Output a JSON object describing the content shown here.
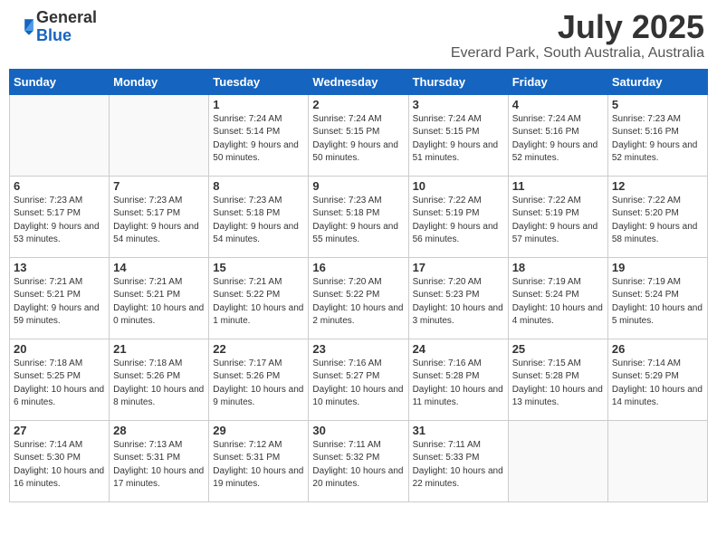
{
  "header": {
    "logo_general": "General",
    "logo_blue": "Blue",
    "month_year": "July 2025",
    "location": "Everard Park, South Australia, Australia"
  },
  "days_of_week": [
    "Sunday",
    "Monday",
    "Tuesday",
    "Wednesday",
    "Thursday",
    "Friday",
    "Saturday"
  ],
  "weeks": [
    [
      {
        "day": "",
        "info": ""
      },
      {
        "day": "",
        "info": ""
      },
      {
        "day": "1",
        "info": "Sunrise: 7:24 AM\nSunset: 5:14 PM\nDaylight: 9 hours and 50 minutes."
      },
      {
        "day": "2",
        "info": "Sunrise: 7:24 AM\nSunset: 5:15 PM\nDaylight: 9 hours and 50 minutes."
      },
      {
        "day": "3",
        "info": "Sunrise: 7:24 AM\nSunset: 5:15 PM\nDaylight: 9 hours and 51 minutes."
      },
      {
        "day": "4",
        "info": "Sunrise: 7:24 AM\nSunset: 5:16 PM\nDaylight: 9 hours and 52 minutes."
      },
      {
        "day": "5",
        "info": "Sunrise: 7:23 AM\nSunset: 5:16 PM\nDaylight: 9 hours and 52 minutes."
      }
    ],
    [
      {
        "day": "6",
        "info": "Sunrise: 7:23 AM\nSunset: 5:17 PM\nDaylight: 9 hours and 53 minutes."
      },
      {
        "day": "7",
        "info": "Sunrise: 7:23 AM\nSunset: 5:17 PM\nDaylight: 9 hours and 54 minutes."
      },
      {
        "day": "8",
        "info": "Sunrise: 7:23 AM\nSunset: 5:18 PM\nDaylight: 9 hours and 54 minutes."
      },
      {
        "day": "9",
        "info": "Sunrise: 7:23 AM\nSunset: 5:18 PM\nDaylight: 9 hours and 55 minutes."
      },
      {
        "day": "10",
        "info": "Sunrise: 7:22 AM\nSunset: 5:19 PM\nDaylight: 9 hours and 56 minutes."
      },
      {
        "day": "11",
        "info": "Sunrise: 7:22 AM\nSunset: 5:19 PM\nDaylight: 9 hours and 57 minutes."
      },
      {
        "day": "12",
        "info": "Sunrise: 7:22 AM\nSunset: 5:20 PM\nDaylight: 9 hours and 58 minutes."
      }
    ],
    [
      {
        "day": "13",
        "info": "Sunrise: 7:21 AM\nSunset: 5:21 PM\nDaylight: 9 hours and 59 minutes."
      },
      {
        "day": "14",
        "info": "Sunrise: 7:21 AM\nSunset: 5:21 PM\nDaylight: 10 hours and 0 minutes."
      },
      {
        "day": "15",
        "info": "Sunrise: 7:21 AM\nSunset: 5:22 PM\nDaylight: 10 hours and 1 minute."
      },
      {
        "day": "16",
        "info": "Sunrise: 7:20 AM\nSunset: 5:22 PM\nDaylight: 10 hours and 2 minutes."
      },
      {
        "day": "17",
        "info": "Sunrise: 7:20 AM\nSunset: 5:23 PM\nDaylight: 10 hours and 3 minutes."
      },
      {
        "day": "18",
        "info": "Sunrise: 7:19 AM\nSunset: 5:24 PM\nDaylight: 10 hours and 4 minutes."
      },
      {
        "day": "19",
        "info": "Sunrise: 7:19 AM\nSunset: 5:24 PM\nDaylight: 10 hours and 5 minutes."
      }
    ],
    [
      {
        "day": "20",
        "info": "Sunrise: 7:18 AM\nSunset: 5:25 PM\nDaylight: 10 hours and 6 minutes."
      },
      {
        "day": "21",
        "info": "Sunrise: 7:18 AM\nSunset: 5:26 PM\nDaylight: 10 hours and 8 minutes."
      },
      {
        "day": "22",
        "info": "Sunrise: 7:17 AM\nSunset: 5:26 PM\nDaylight: 10 hours and 9 minutes."
      },
      {
        "day": "23",
        "info": "Sunrise: 7:16 AM\nSunset: 5:27 PM\nDaylight: 10 hours and 10 minutes."
      },
      {
        "day": "24",
        "info": "Sunrise: 7:16 AM\nSunset: 5:28 PM\nDaylight: 10 hours and 11 minutes."
      },
      {
        "day": "25",
        "info": "Sunrise: 7:15 AM\nSunset: 5:28 PM\nDaylight: 10 hours and 13 minutes."
      },
      {
        "day": "26",
        "info": "Sunrise: 7:14 AM\nSunset: 5:29 PM\nDaylight: 10 hours and 14 minutes."
      }
    ],
    [
      {
        "day": "27",
        "info": "Sunrise: 7:14 AM\nSunset: 5:30 PM\nDaylight: 10 hours and 16 minutes."
      },
      {
        "day": "28",
        "info": "Sunrise: 7:13 AM\nSunset: 5:31 PM\nDaylight: 10 hours and 17 minutes."
      },
      {
        "day": "29",
        "info": "Sunrise: 7:12 AM\nSunset: 5:31 PM\nDaylight: 10 hours and 19 minutes."
      },
      {
        "day": "30",
        "info": "Sunrise: 7:11 AM\nSunset: 5:32 PM\nDaylight: 10 hours and 20 minutes."
      },
      {
        "day": "31",
        "info": "Sunrise: 7:11 AM\nSunset: 5:33 PM\nDaylight: 10 hours and 22 minutes."
      },
      {
        "day": "",
        "info": ""
      },
      {
        "day": "",
        "info": ""
      }
    ]
  ]
}
